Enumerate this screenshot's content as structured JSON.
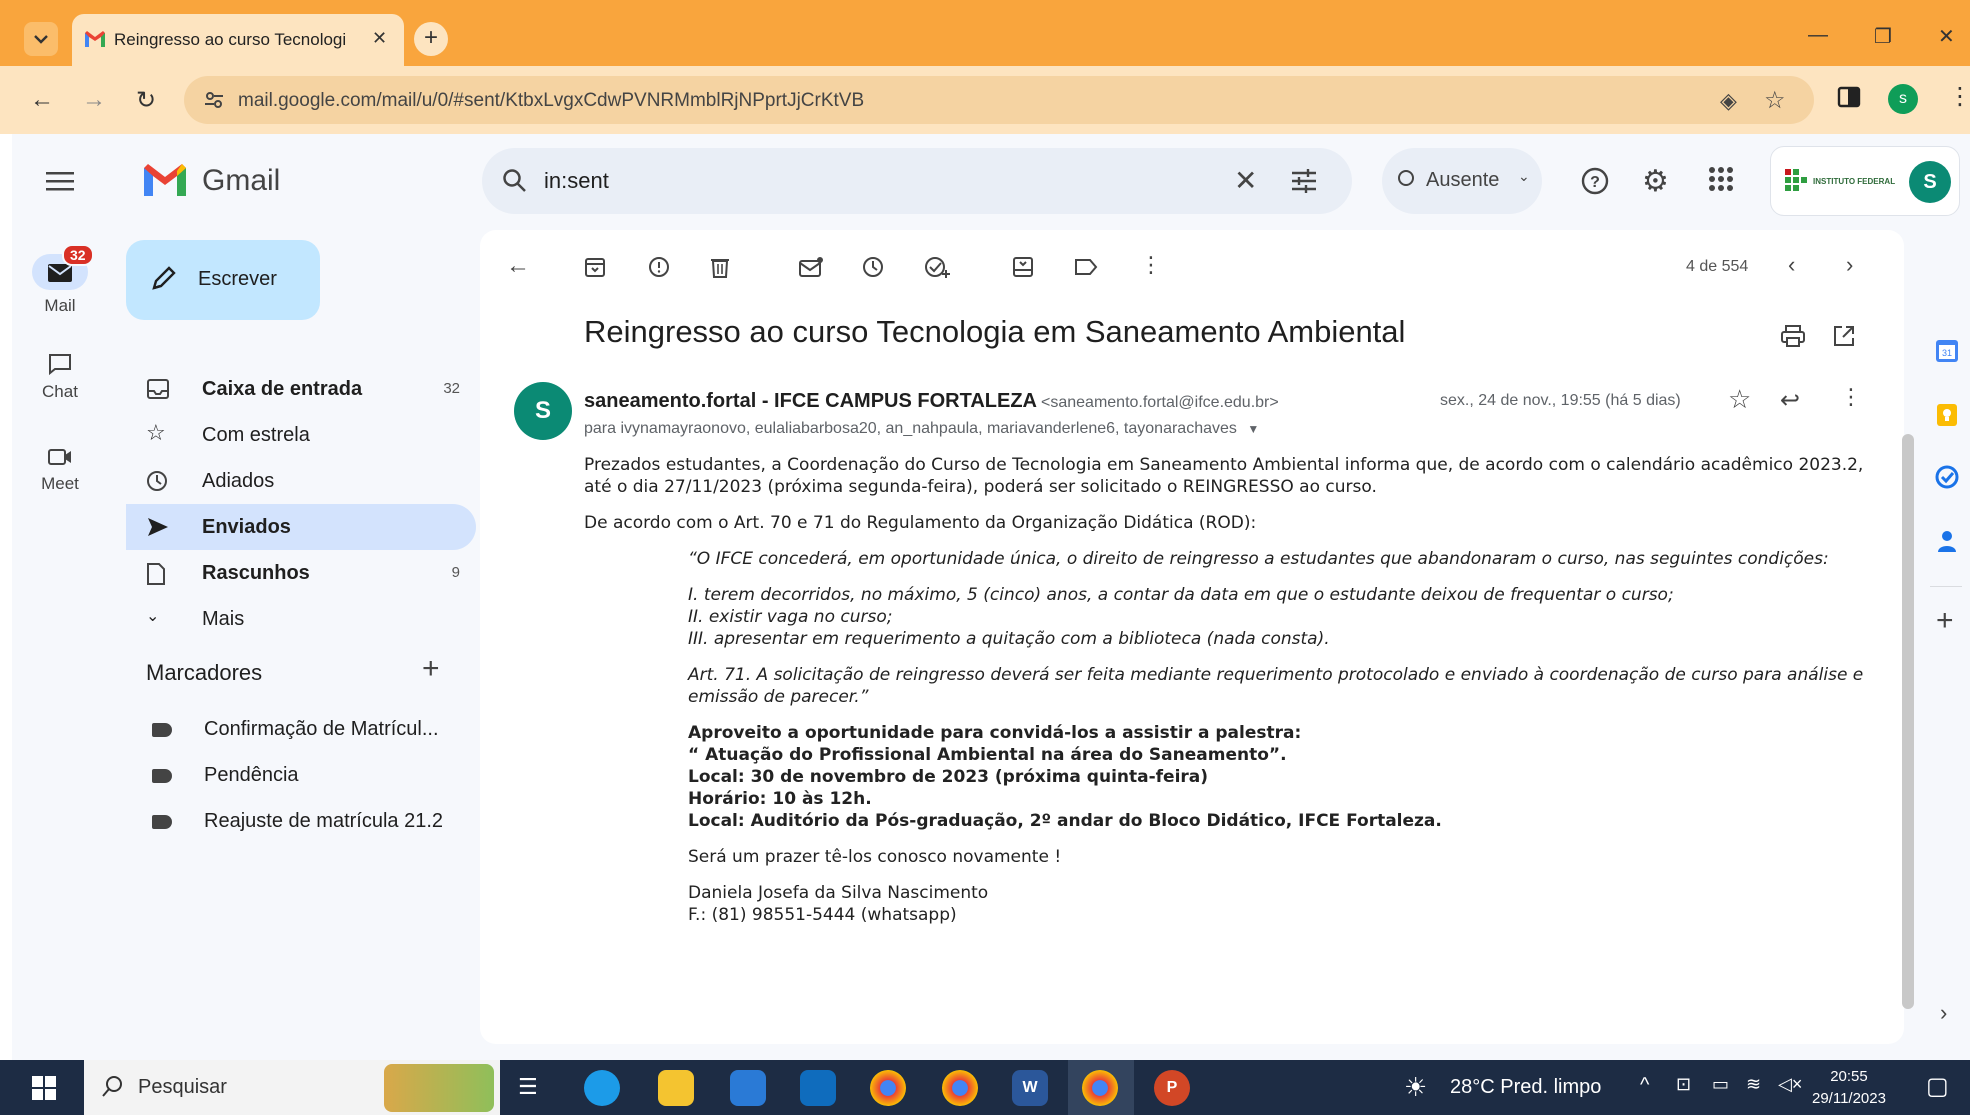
{
  "browser": {
    "tab_title": "Reingresso ao curso Tecnologi",
    "url": "mail.google.com/mail/u/0/#sent/KtbxLvgxCdwPVNRMmblRjNPprtJjCrKtVB",
    "profile_initial": "s"
  },
  "gmail": {
    "brand": "Gmail",
    "search_query": "in:sent",
    "status_label": "Ausente",
    "org_label": "INSTITUTO FEDERAL",
    "avatar_initial": "S",
    "rail": [
      {
        "label": "Mail",
        "badge": "32"
      },
      {
        "label": "Chat"
      },
      {
        "label": "Meet"
      }
    ],
    "compose_label": "Escrever",
    "nav": [
      {
        "label": "Caixa de entrada",
        "count": "32"
      },
      {
        "label": "Com estrela",
        "count": ""
      },
      {
        "label": "Adiados",
        "count": ""
      },
      {
        "label": "Enviados",
        "count": ""
      },
      {
        "label": "Rascunhos",
        "count": "9"
      },
      {
        "label": "Mais",
        "count": ""
      }
    ],
    "labels_heading": "Marcadores",
    "labels": [
      "Confirmação de Matrícul...",
      "Pendência",
      "Reajuste de matrícula 21.2"
    ],
    "pager": "4 de 554"
  },
  "message": {
    "subject": "Reingresso ao curso Tecnologia em Saneamento Ambiental",
    "sender_initial": "S",
    "sender_name": "saneamento.fortal - IFCE CAMPUS FORTALEZA",
    "sender_email": "<saneamento.fortal@ifce.edu.br>",
    "date": "sex., 24 de nov., 19:55 (há 5 dias)",
    "recipients": "para ivynamayraonovo, eulaliabarbosa20, an_nahpaula, mariavanderlene6, tayonarachaves",
    "p1": "Prezados estudantes, a Coordenação do Curso de Tecnologia em Saneamento Ambiental informa que, de acordo com o calendário acadêmico 2023.2, até o dia 27/11/2023 (próxima segunda-feira), poderá ser solicitado o REINGRESSO ao curso.",
    "p2": "De acordo com o Art. 70 e 71 do Regulamento da Organização Didática (ROD):",
    "quote1": "“O IFCE concederá, em oportunidade única, o direito de reingresso a estudantes que abandonaram o curso, nas seguintes condições:",
    "cond1": "I.   terem decorridos, no máximo, 5 (cinco) anos, a contar da data em que o estudante deixou de frequentar o curso;",
    "cond2": "II.  existir vaga no curso;",
    "cond3": "III. apresentar em requerimento a quitação com a biblioteca (nada consta).",
    "quote2": "Art. 71. A solicitação de reingresso deverá ser feita mediante requerimento protocolado e enviado à coordenação de curso para análise e emissão de parecer.”",
    "b1": "Aproveito a oportunidade para convidá-los a assistir a palestra:",
    "b2": "“ Atuação do Profissional Ambiental na área do Saneamento”.",
    "b3": "Local: 30 de novembro de 2023 (próxima quinta-feira)",
    "b4": "Horário: 10 às 12h.",
    "b5": "Local: Auditório da Pós-graduação, 2º andar do Bloco Didático, IFCE Fortaleza.",
    "closing": "Será um prazer tê-los conosco novamente !",
    "sig1": "Daniela Josefa da Silva Nascimento",
    "sig2": "F.: (81) 98551-5444 (whatsapp)"
  },
  "taskbar": {
    "search_label": "Pesquisar",
    "weather": "28°C  Pred. limpo",
    "time": "20:55",
    "date": "29/11/2023"
  },
  "colors": {
    "chrome_frame": "#f9a53d",
    "active_nav": "#d3e3fd",
    "compose": "#c2e7ff",
    "taskbar": "#1d2c44"
  }
}
